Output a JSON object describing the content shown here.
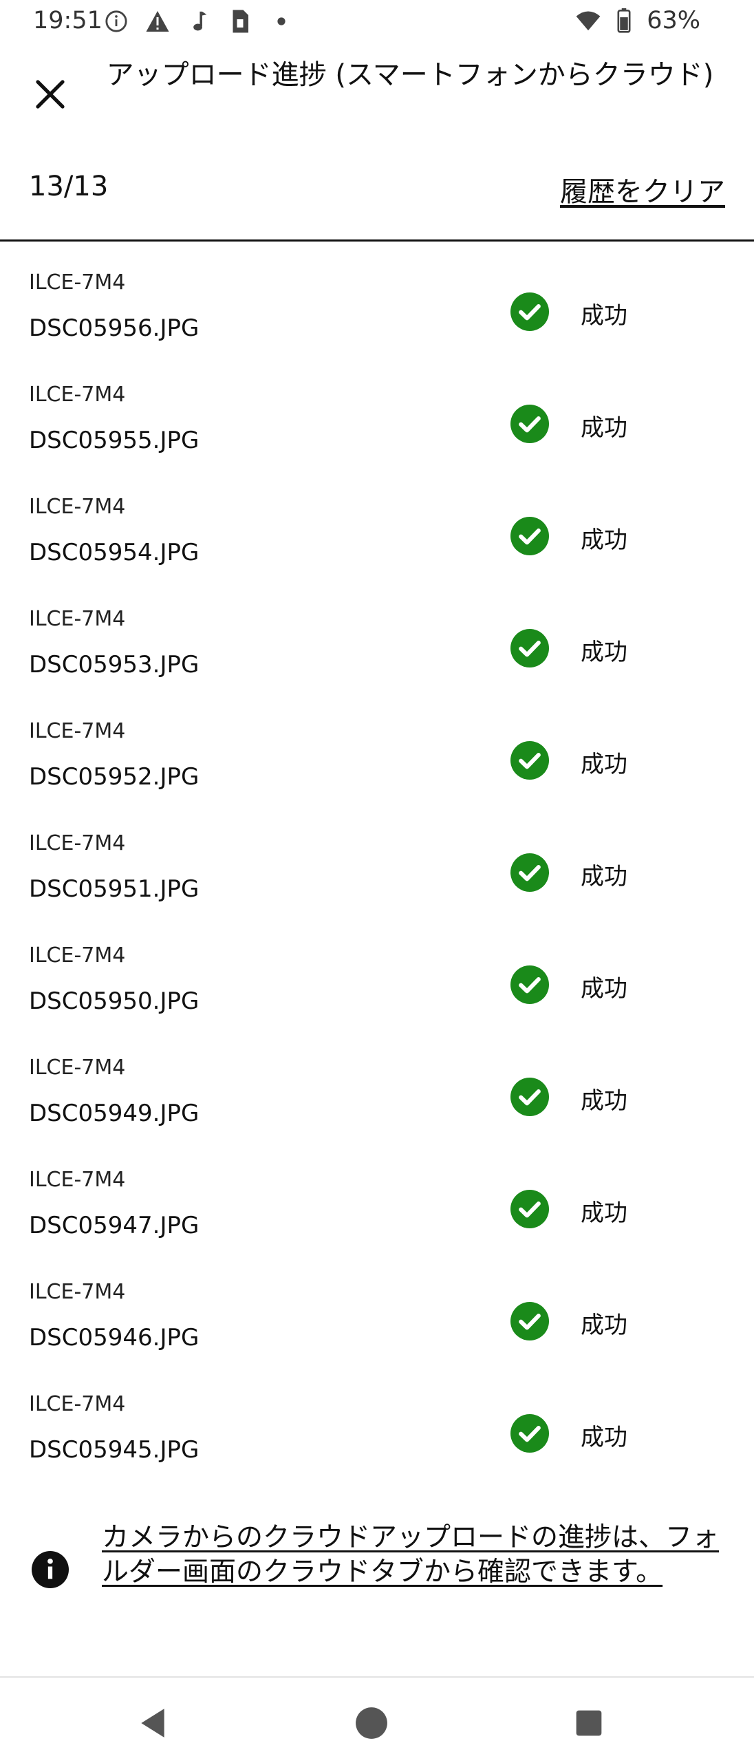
{
  "status_bar": {
    "time": "19:51",
    "battery": "63%",
    "left_icons": [
      "info-icon",
      "warning-icon",
      "music-note-icon",
      "sim-card-icon",
      "dot-icon"
    ],
    "right_icons": [
      "wifi-icon",
      "battery-icon"
    ]
  },
  "header": {
    "title": "アップロード進捗 (スマートフォンからクラウド)",
    "close_icon": "close-icon"
  },
  "summary": {
    "count": "13/13",
    "clear_history": "履歴をクリア"
  },
  "uploads": [
    {
      "device": "ILCE-7M4",
      "file": "DSC05956.JPG",
      "status": "成功"
    },
    {
      "device": "ILCE-7M4",
      "file": "DSC05955.JPG",
      "status": "成功"
    },
    {
      "device": "ILCE-7M4",
      "file": "DSC05954.JPG",
      "status": "成功"
    },
    {
      "device": "ILCE-7M4",
      "file": "DSC05953.JPG",
      "status": "成功"
    },
    {
      "device": "ILCE-7M4",
      "file": "DSC05952.JPG",
      "status": "成功"
    },
    {
      "device": "ILCE-7M4",
      "file": "DSC05951.JPG",
      "status": "成功"
    },
    {
      "device": "ILCE-7M4",
      "file": "DSC05950.JPG",
      "status": "成功"
    },
    {
      "device": "ILCE-7M4",
      "file": "DSC05949.JPG",
      "status": "成功"
    },
    {
      "device": "ILCE-7M4",
      "file": "DSC05947.JPG",
      "status": "成功"
    },
    {
      "device": "ILCE-7M4",
      "file": "DSC05946.JPG",
      "status": "成功"
    },
    {
      "device": "ILCE-7M4",
      "file": "DSC05945.JPG",
      "status": "成功"
    }
  ],
  "notice": {
    "text": "カメラからのクラウドアップロードの進捗は、フォルダー画面のクラウドタブから確認できます。",
    "icon": "info-icon"
  },
  "colors": {
    "success": "#1a8a1a",
    "text": "#111111",
    "divider": "#111111"
  },
  "nav_bar": {
    "icons": [
      "back-icon",
      "home-icon",
      "recents-icon"
    ]
  }
}
